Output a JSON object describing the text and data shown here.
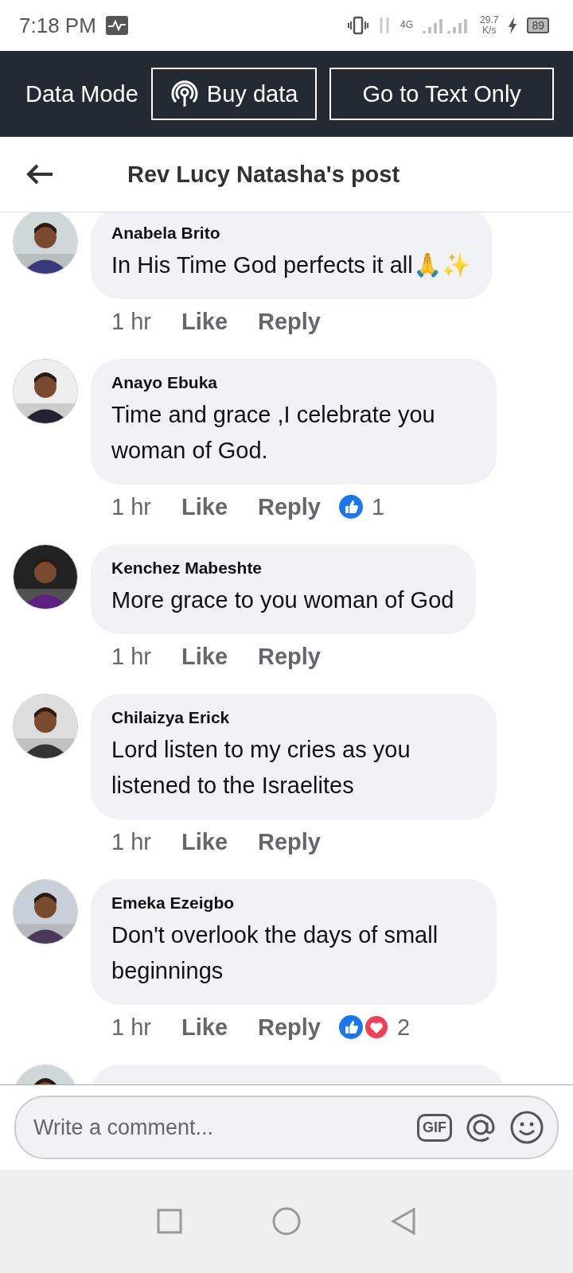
{
  "status_bar": {
    "time": "7:18 PM",
    "network": "4G",
    "speed": "29.7",
    "speed_unit": "K/s",
    "battery": "89"
  },
  "data_bar": {
    "label": "Data Mode",
    "buttons": [
      {
        "kind": "buy",
        "label": "Buy data"
      },
      {
        "kind": "text",
        "label": "Go to Text Only"
      }
    ]
  },
  "header": {
    "title": "Rev Lucy Natasha's post"
  },
  "comments": [
    {
      "author": "Anabela Brito",
      "text": "In His Time God perfects it all🙏✨",
      "time": "1 hr",
      "like": "Like",
      "reply": "Reply"
    },
    {
      "author": "Anayo Ebuka",
      "text": "Time and grace ,I celebrate you woman of God.",
      "time": "1 hr",
      "like": "Like",
      "reply": "Reply",
      "reactions": [
        {
          "kind": "like"
        }
      ],
      "count": "1"
    },
    {
      "author": "Kenchez Mabeshte",
      "text": "More grace to you woman of God",
      "time": "1 hr",
      "like": "Like",
      "reply": "Reply"
    },
    {
      "author": "Chilaizya Erick",
      "text": "Lord listen to my cries as you listened to the Israelites",
      "time": "1 hr",
      "like": "Like",
      "reply": "Reply"
    },
    {
      "author": "Emeka Ezeigbo",
      "text": "Don't overlook the days of small beginnings",
      "time": "1 hr",
      "like": "Like",
      "reply": "Reply",
      "reactions": [
        {
          "kind": "like"
        },
        {
          "kind": "love"
        }
      ],
      "count": "2"
    }
  ],
  "composer": {
    "placeholder": "Write a comment...",
    "gif": "GIF"
  }
}
